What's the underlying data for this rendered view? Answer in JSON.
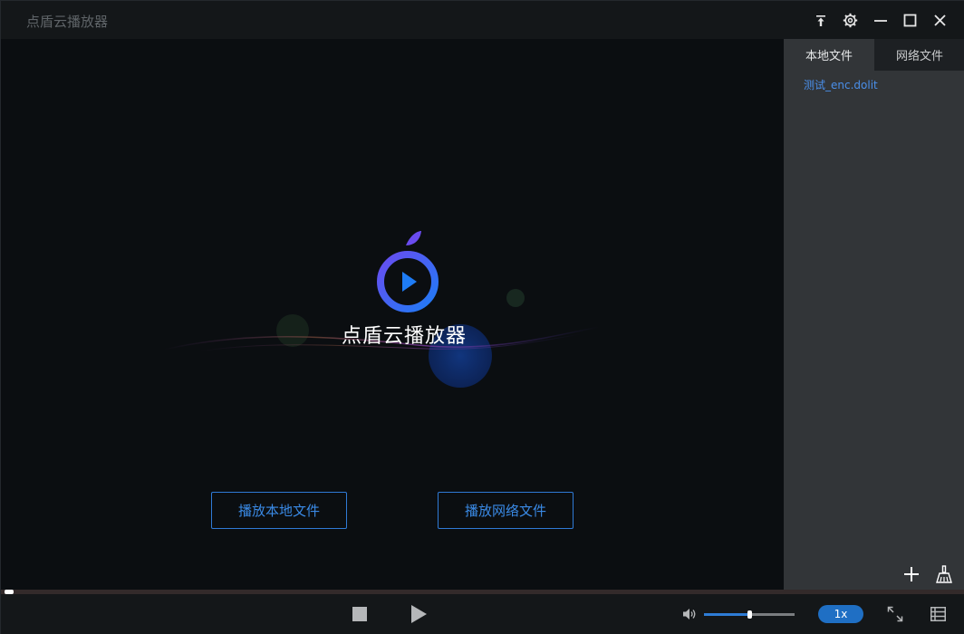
{
  "app": {
    "title": "点盾云播放器"
  },
  "window_controls": {
    "pin_icon": "pin-icon",
    "settings_icon": "gear-icon",
    "minimize_icon": "minimize-icon",
    "maximize_icon": "maximize-icon",
    "close_icon": "close-icon"
  },
  "splash": {
    "title": "点盾云播放器",
    "play_local_label": "播放本地文件",
    "play_network_label": "播放网络文件"
  },
  "panel": {
    "tabs": [
      {
        "label": "本地文件",
        "active": true
      },
      {
        "label": "网络文件",
        "active": false
      }
    ],
    "files": [
      {
        "name": "测试_enc.dolit"
      }
    ],
    "add_icon": "plus-icon",
    "clear_icon": "broom-icon"
  },
  "playback": {
    "progress": 0.0,
    "volume": 0.5,
    "speed": "1x"
  },
  "colors": {
    "accent": "#2e7cd6",
    "background": "#0b0e11",
    "titlebar": "#141719",
    "panel": "#323538",
    "link": "#4a8fea"
  }
}
